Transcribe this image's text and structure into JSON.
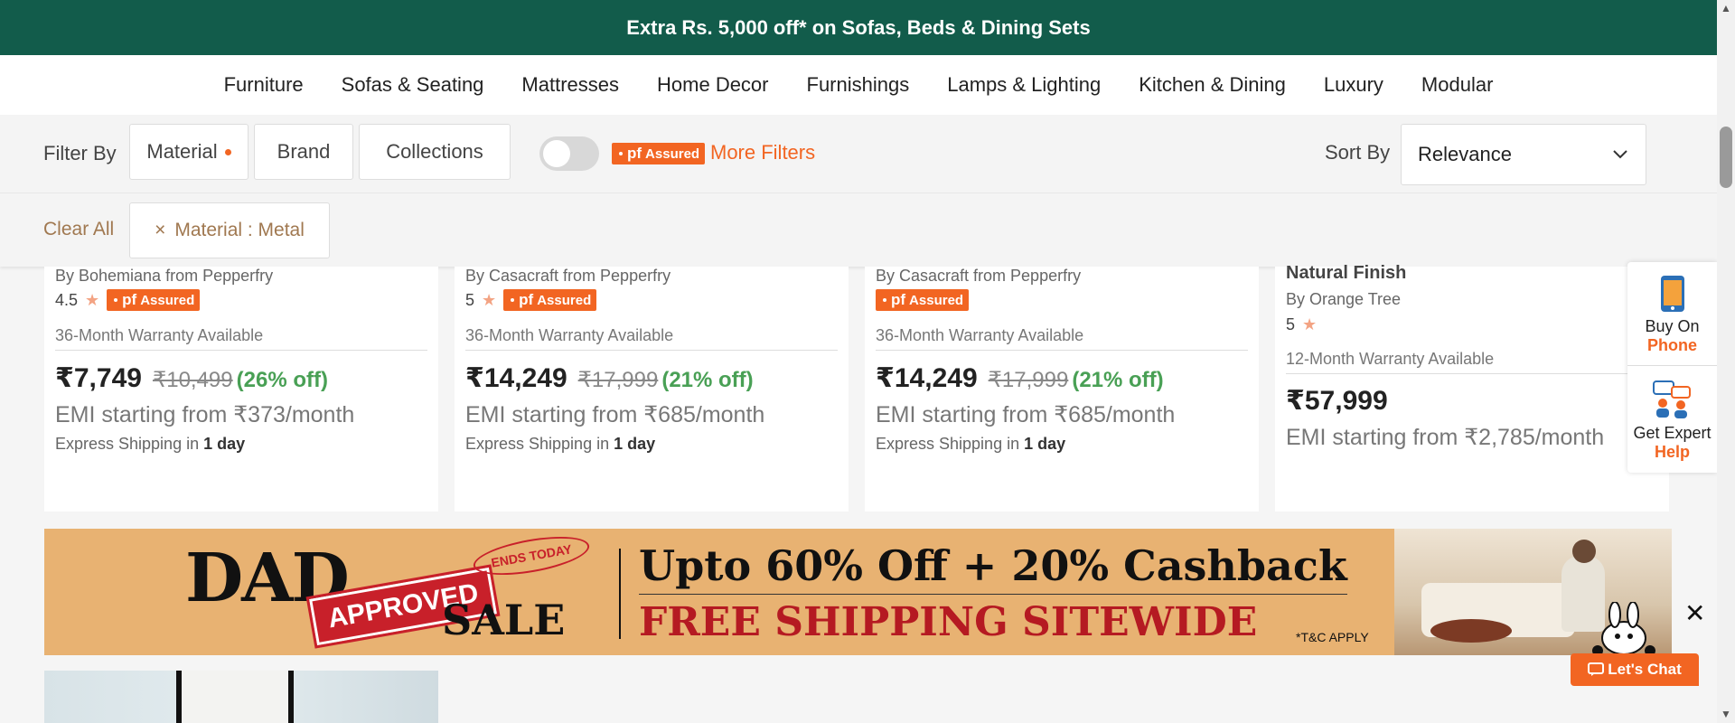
{
  "promo_bar": {
    "text": "Extra Rs. 5,000 off* on Sofas, Beds & Dining Sets"
  },
  "nav": {
    "items": [
      "Furniture",
      "Sofas & Seating",
      "Mattresses",
      "Home Decor",
      "Furnishings",
      "Lamps & Lighting",
      "Kitchen & Dining",
      "Luxury",
      "Modular"
    ]
  },
  "filters": {
    "label": "Filter By",
    "buttons": [
      "Material",
      "Brand",
      "Collections"
    ],
    "pf_badge": {
      "pf": "pf",
      "text": "Assured"
    },
    "more_filters": "More Filters",
    "sort_label": "Sort By",
    "sort_value": "Relevance",
    "clear_all": "Clear All",
    "chip": {
      "close": "×",
      "text": "Material : Metal"
    }
  },
  "products": [
    {
      "brand": "By Bohemiana from Pepperfry",
      "rating": "4.5",
      "warranty": "36-Month Warranty Available",
      "price": "₹7,749",
      "mrp": "₹10,499",
      "off": "(26% off)",
      "emi": "EMI starting from ₹373/month",
      "ship_prefix": "Express Shipping in",
      "ship_days": "1 day"
    },
    {
      "brand": "By Casacraft from Pepperfry",
      "rating": "5",
      "warranty": "36-Month Warranty Available",
      "price": "₹14,249",
      "mrp": "₹17,999",
      "off": "(21% off)",
      "emi": "EMI starting from ₹685/month",
      "ship_prefix": "Express Shipping in",
      "ship_days": "1 day"
    },
    {
      "brand": "By Casacraft from Pepperfry",
      "warranty": "36-Month Warranty Available",
      "price": "₹14,249",
      "mrp": "₹17,999",
      "off": "(21% off)",
      "emi": "EMI starting from ₹685/month",
      "ship_prefix": "Express Shipping in",
      "ship_days": "1 day"
    },
    {
      "title": "Natural Finish",
      "brand": "By Orange Tree",
      "rating": "5",
      "warranty": "12-Month Warranty Available",
      "price": "₹57,999",
      "emi": "EMI starting from ₹2,785/month"
    }
  ],
  "side_widget": {
    "buy_label": "Buy On",
    "buy_accent": "Phone",
    "help_label": "Get Expert",
    "help_accent": "Help"
  },
  "banner": {
    "dad": "DAD",
    "approved": "APPROVED",
    "ends_today": "ENDS TODAY",
    "sale": "SALE",
    "headline": "Upto 60% Off + 20% Cashback",
    "sub": "FREE SHIPPING SITEWIDE",
    "tc": "*T&C  APPLY",
    "close": "✕"
  },
  "chat": {
    "label": "Let's Chat"
  },
  "colors": {
    "promo_bg": "#125c4b",
    "accent": "#f26522",
    "discount": "#49a055",
    "banner_bg": "#e8b272",
    "banner_red": "#b51a22"
  }
}
